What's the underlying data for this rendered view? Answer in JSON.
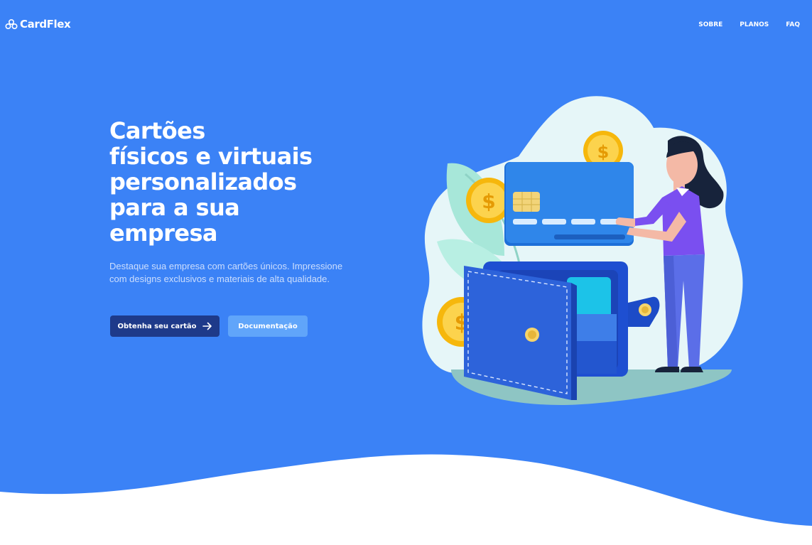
{
  "brand": {
    "name": "CardFlex",
    "icon": "three-circles-logo-icon"
  },
  "nav": {
    "items": [
      {
        "label": "SOBRE"
      },
      {
        "label": "PLANOS"
      },
      {
        "label": "FAQ"
      }
    ]
  },
  "hero": {
    "title": "Cartões\nfísicos e virtuais\npersonalizados\npara a sua\nempresa",
    "description": "Destaque sua empresa com cartões únicos. Impressione com designs exclusivos e materiais de alta qualidade.",
    "primary_button": {
      "label": "Obtenha seu cartão",
      "icon": "arrow-right-icon"
    },
    "secondary_button": {
      "label": "Documentação"
    }
  },
  "colors": {
    "background": "#3b82f6",
    "primary_button": "#1e3a8a",
    "secondary_button": "#60a5fa",
    "wave": "#ffffff"
  }
}
